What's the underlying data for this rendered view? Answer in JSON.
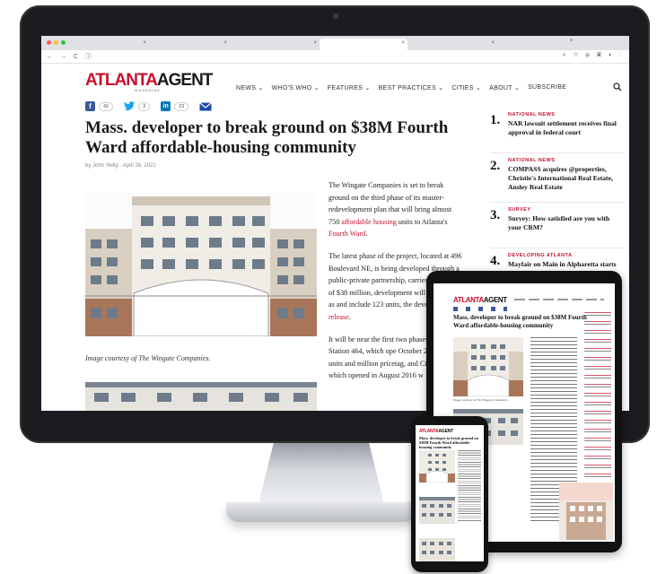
{
  "browser": {
    "tabs": [
      {
        "label": ""
      },
      {
        "label": ""
      },
      {
        "label": ""
      },
      {
        "label": ""
      },
      {
        "label": ""
      }
    ],
    "nav_icons": "← → C ⓘ",
    "ext_icons": "⌕ ☆ ⊕ ▣ ◐ ⋮"
  },
  "site": {
    "logo_part1": "ATLANTA",
    "logo_part2": "AGENT",
    "logo_sub": "MAGAZINE",
    "nav": [
      "NEWS",
      "WHO'S WHO",
      "FEATURES",
      "BEST PRACTICES",
      "CITIES",
      "ABOUT",
      "SUBSCRIBE"
    ]
  },
  "article": {
    "shares": {
      "facebook": "42",
      "twitter": "3",
      "linkedin": "23"
    },
    "headline": "Mass. developer to break ground on $38M Fourth Ward affordable-housing community",
    "byline": "by John Yellig · April 28, 2021",
    "caption": "Image courtesy of The Wingate Companies.",
    "p1_a": "The Wingate Companies is set to break ground on the third phase of its master-redevelopment plan that will bring almost 750 ",
    "p1_link1": "affordable housing",
    "p1_b": " units to Atlanta's ",
    "p1_link2": "Fourth Ward",
    "p1_c": ".",
    "p2_a": "The latest phase of the project, located at 496 Boulevard NE, is being developed through a public-private partnership, carries a total cost of $38 million, development will be known as and include 123 units, the devel a ",
    "p2_link": "press release",
    "p2_b": ".",
    "p3": "It will be near the first two phases project, Station 464, which ope October 2019 with 96 units and million pricetag, and City Light which opened in August 2016 w"
  },
  "sidebar": [
    {
      "num": "1.",
      "category": "NATIONAL NEWS",
      "title": "NAR lawsuit settlement receives final approval in federal court"
    },
    {
      "num": "2.",
      "category": "NATIONAL NEWS",
      "title": "COMPASS acquires @properties, Christie's International Real Estate, Ansley Real Estate"
    },
    {
      "num": "3.",
      "category": "SURVEY",
      "title": "Survey: How satisfied are you with your CRM?"
    },
    {
      "num": "4.",
      "category": "DEVELOPING ATLANTA",
      "title": "Mayfair on Main in Alpharetta starts selling"
    }
  ],
  "tablet": {
    "logo_part1": "ATLANTA",
    "logo_part2": "AGENT",
    "headline": "Mass. developer to break ground on $38M Fourth Ward affordable-housing community",
    "caption": "Image courtesy of The Wingate Companies."
  },
  "phone": {
    "logo_part1": "ATLANTA",
    "logo_part2": "AGENT",
    "headline": "Mass. developer to break ground on $38M Fourth Ward affordable-housing community"
  },
  "colors": {
    "brand_red": "#c8102e",
    "facebook": "#3b5998",
    "twitter": "#1da1f2",
    "linkedin": "#0077b5",
    "email": "#1a4aa8"
  }
}
